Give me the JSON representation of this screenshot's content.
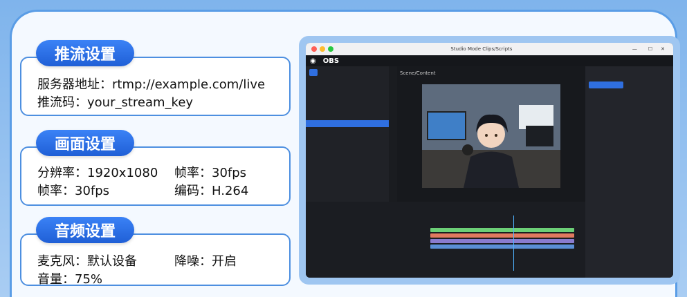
{
  "stream": {
    "title": "推流设置",
    "server": "服务器地址：rtmp://example.com/live",
    "key": "推流码：your_stream_key"
  },
  "video": {
    "title": "画面设置",
    "resolution": "分辨率：1920x1080",
    "fps_a": "帧率：30fps",
    "fps_b": "帧率：30fps",
    "codec": "编码：H.264"
  },
  "audio": {
    "title": "音频设置",
    "mic": "麦克风：默认设备",
    "denoise": "降噪：开启",
    "volume": "音量：75%"
  },
  "obs": {
    "logo": "OBS",
    "window_title": "Studio Mode Clips/Scripts",
    "preview_label": "Scene/Content",
    "colors": {
      "accent": "#2f6fe0",
      "bg": "#1d1f24"
    }
  }
}
